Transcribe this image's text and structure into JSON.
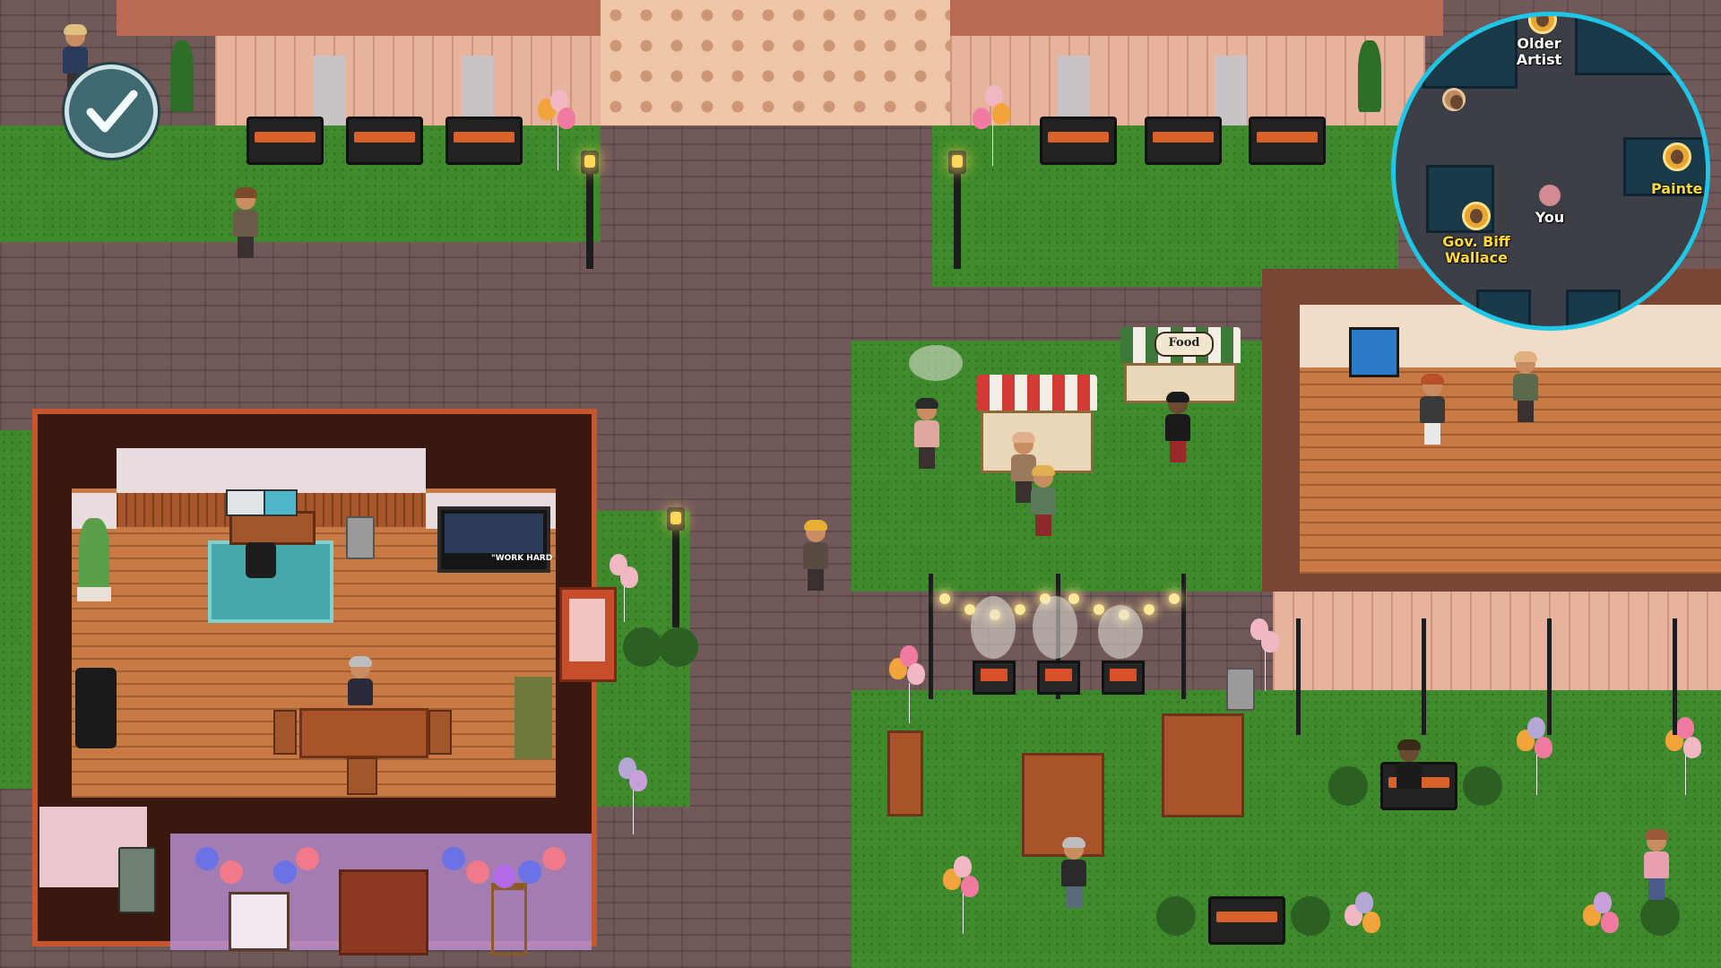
{
  "hud": {
    "task_complete_icon": "checkmark-icon"
  },
  "tv": {
    "caption": "\"WORK HARD"
  },
  "food_stall": {
    "sign": "Food"
  },
  "minimap": {
    "labels": {
      "older_artist": "Older\nArtist",
      "painter": "Painte",
      "governor": "Gov. Biff\nWallace",
      "you": "You"
    },
    "colors": {
      "border": "#1fc6e6",
      "npc_label": "#ffd83a",
      "you_dot": "#d28a93"
    }
  }
}
